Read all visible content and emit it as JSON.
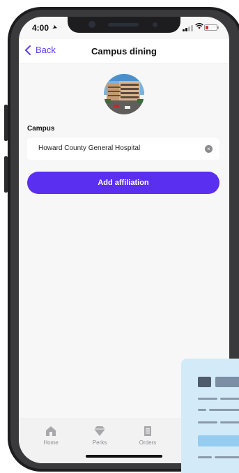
{
  "status_bar": {
    "time": "4:00"
  },
  "nav": {
    "back_label": "Back",
    "title": "Campus dining"
  },
  "campus": {
    "field_label": "Campus",
    "selected_value": "Howard County General Hospital",
    "photo_icon": "campus-building-photo"
  },
  "actions": {
    "add_affiliation_label": "Add affiliation"
  },
  "tab_bar": {
    "items": [
      {
        "label": "Home",
        "icon": "home-icon"
      },
      {
        "label": "Perks",
        "icon": "diamond-icon"
      },
      {
        "label": "Orders",
        "icon": "receipt-icon"
      }
    ]
  },
  "colors": {
    "accent": "#5b2ff0",
    "link": "#5b3df5",
    "screen_background": "#f7f7f8",
    "overlay_card": "#d3ebf8"
  }
}
